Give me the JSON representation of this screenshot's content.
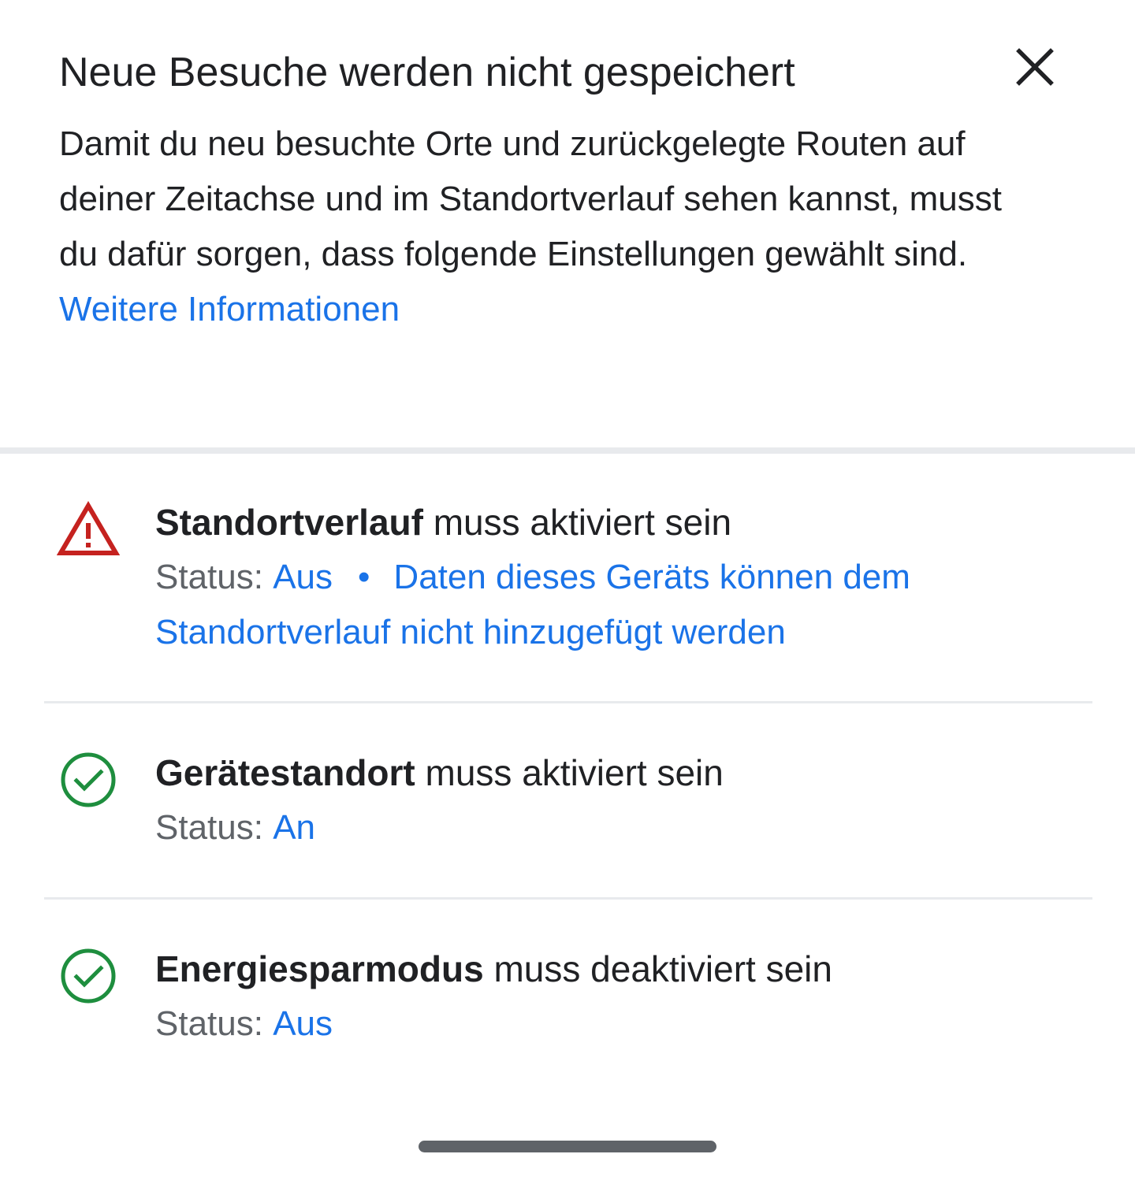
{
  "dialog": {
    "title": "Neue Besuche werden nicht gespeichert",
    "close_icon": "close-icon",
    "description": "Damit du neu besuchte Orte und zurückgelegte Routen auf deiner Zeitachse und im Standortverlauf sehen kannst, musst du dafür sorgen, dass folgende Einstellungen gewählt sind.",
    "learn_more_link": "Weitere Informationen"
  },
  "requirements": [
    {
      "icon": "warning-icon",
      "icon_color": "#c5221f",
      "title_strong": "Standortverlauf",
      "title_rest": " muss aktiviert sein",
      "status_label": "Status: ",
      "status_value": "Aus",
      "separator": "•",
      "note": "Daten dieses Geräts können dem Standortverlauf nicht hinzugefügt werden"
    },
    {
      "icon": "check-circle-icon",
      "icon_color": "#1e8e3e",
      "title_strong": "Gerätestandort",
      "title_rest": " muss aktiviert sein",
      "status_label": "Status: ",
      "status_value": "An"
    },
    {
      "icon": "check-circle-icon",
      "icon_color": "#1e8e3e",
      "title_strong": "Energiesparmodus",
      "title_rest": " muss deaktiviert sein",
      "status_label": "Status: ",
      "status_value": "Aus"
    }
  ],
  "colors": {
    "link": "#1a73e8",
    "text_primary": "#202124",
    "text_secondary": "#5f6368",
    "divider": "#e8eaed"
  }
}
